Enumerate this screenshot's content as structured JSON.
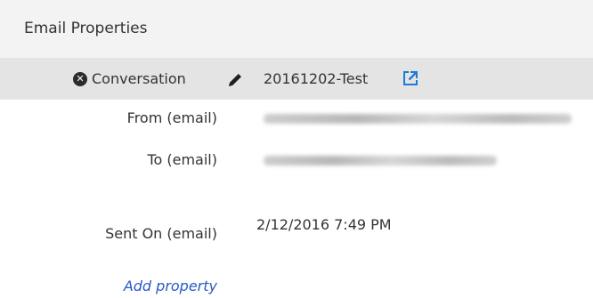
{
  "panel": {
    "title": "Email Properties"
  },
  "conversation": {
    "label": "Conversation",
    "value": "20161202-Test",
    "remove_icon": "circle-x-icon",
    "edit_icon": "pencil-icon",
    "open_icon": "external-link-icon",
    "accent": "#1e7ad8"
  },
  "properties": [
    {
      "label": "From (email)",
      "value": ""
    },
    {
      "label": "To (email)",
      "value": ""
    },
    {
      "label": "Sent On (email)",
      "value": "2/12/2016 7:49 PM"
    }
  ],
  "actions": {
    "add_property": "Add property"
  },
  "colors": {
    "header_bg": "#f3f3f3",
    "row_bg": "#e4e4e4",
    "link": "#2a58c8"
  }
}
